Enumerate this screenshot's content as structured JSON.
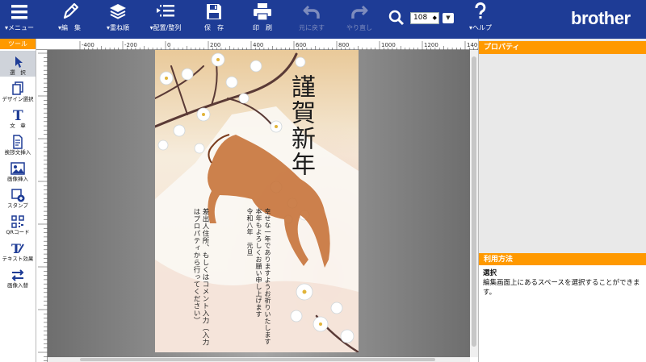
{
  "toolbar": {
    "menu": "メニュー",
    "edit": "編　集",
    "layers": "重ね順",
    "arrange": "配置/整列",
    "save": "保　存",
    "print": "印　刷",
    "undo": "元に戻す",
    "redo": "やり直し",
    "zoom": "108",
    "help": "ヘルプ"
  },
  "brand": "brother",
  "tools": {
    "header": "ツール",
    "items": [
      "選　択",
      "デザイン選択",
      "文　章",
      "挨拶文挿入",
      "画像挿入",
      "スタンプ",
      "QRコード",
      "テキスト効果",
      "画像入替"
    ]
  },
  "ruler": {
    "labels": [
      "-400",
      "-200",
      "0",
      "200",
      "400",
      "600",
      "800",
      "1000",
      "1200",
      "1400"
    ]
  },
  "card": {
    "greeting": "謹賀新年",
    "message": "幸せな一年でありますようお祈りいたします\n本年もよろしくお願い申し上げます\n令和八年　元旦",
    "instruction": "差出人住所、もしくはコメント入力（入力\nはプロパティから行ってください）"
  },
  "panel": {
    "properties_title": "プロパティ",
    "usage_title": "利用方法",
    "usage_subtitle": "選択",
    "usage_text": "編集画面上にあるスペースを選択することができます。"
  },
  "colors": {
    "topbar": "#1e3c96",
    "accent": "#ff9900"
  }
}
